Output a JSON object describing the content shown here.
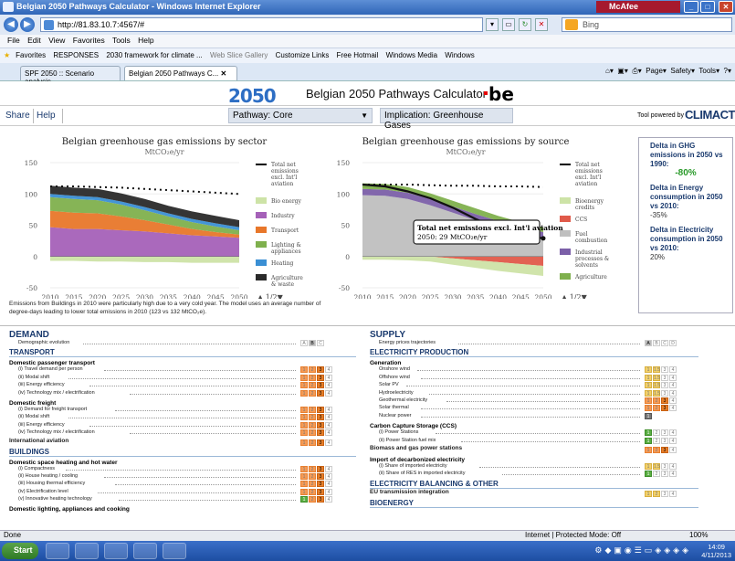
{
  "window": {
    "title": "Belgian 2050 Pathways Calculator - Windows Internet Explorer",
    "mcafee": "McAfee"
  },
  "address": {
    "url": "http://81.83.10.7:4567/#",
    "search_placeholder": "Bing"
  },
  "menu": [
    "File",
    "Edit",
    "View",
    "Favorites",
    "Tools",
    "Help"
  ],
  "favorites": {
    "label": "Favorites",
    "items": [
      "RESPONSES",
      "2030 framework for climate ...",
      "Web Slice Gallery",
      "Customize Links",
      "Free Hotmail",
      "Windows Media",
      "Windows"
    ]
  },
  "tabs": [
    {
      "label": "SPF 2050 :: Scenario analysis"
    },
    {
      "label": "Belgian 2050 Pathways C..."
    }
  ],
  "ie_tools": {
    "page": "Page",
    "safety": "Safety",
    "tools": "Tools"
  },
  "app": {
    "logo": "2050",
    "title": "Belgian 2050 Pathways Calculator",
    "country": "be",
    "share": "Share",
    "help": "Help",
    "pathway": "Pathway: Core",
    "implication": "Implication: Greenhouse Gases",
    "powered_by": "Tool powered by",
    "brand": "CLIMACT"
  },
  "chart_data": [
    {
      "type": "area",
      "title": "Belgian greenhouse gas emissions by sector",
      "subtitle": "MtCO₂e/yr",
      "x": [
        2010,
        2015,
        2020,
        2025,
        2030,
        2035,
        2040,
        2045,
        2050
      ],
      "ylim": [
        -50,
        150
      ],
      "yticks": [
        -50,
        0,
        50,
        100,
        150
      ],
      "series": [
        {
          "name": "Industry",
          "color": "#a561b8",
          "values": [
            47,
            44,
            44,
            42,
            40,
            37,
            34,
            32,
            30
          ]
        },
        {
          "name": "Transport",
          "color": "#e8772a",
          "values": [
            26,
            26,
            25,
            22,
            18,
            14,
            10,
            7,
            5
          ]
        },
        {
          "name": "Lighting & appliances",
          "color": "#7fb04d",
          "values": [
            22,
            22,
            21,
            19,
            16,
            13,
            11,
            9,
            7
          ]
        },
        {
          "name": "Heating",
          "color": "#3a8fd4",
          "values": [
            5,
            5,
            5,
            5,
            5,
            5,
            5,
            5,
            5
          ]
        },
        {
          "name": "Agriculture & waste",
          "color": "#2a2a2a",
          "values": [
            13,
            13,
            13,
            13,
            13,
            12,
            12,
            12,
            11
          ]
        },
        {
          "name": "Bio energy",
          "color": "#cde3a7",
          "values": [
            -7,
            -7,
            -8,
            -8,
            -9,
            -9,
            -10,
            -10,
            -10
          ]
        }
      ],
      "lines": [
        {
          "name": "Total net emissions excl. Int'l aviation",
          "values": [
            112,
            112,
            111,
            109,
            102,
            93,
            82,
            72,
            62
          ]
        }
      ],
      "legend_page": "1/2"
    },
    {
      "type": "area",
      "title": "Belgian greenhouse gas emissions by source",
      "subtitle": "MtCO₂e/yr",
      "x": [
        2010,
        2015,
        2020,
        2025,
        2030,
        2035,
        2040,
        2045,
        2050
      ],
      "ylim": [
        -50,
        150
      ],
      "yticks": [
        -50,
        0,
        50,
        100,
        150
      ],
      "series": [
        {
          "name": "Fuel combustion",
          "color": "#bfbfbf",
          "values": [
            98,
            97,
            92,
            82,
            70,
            58,
            47,
            37,
            29
          ]
        },
        {
          "name": "Industrial processes & solvents",
          "color": "#7b5fa8",
          "values": [
            10,
            10,
            10,
            10,
            10,
            10,
            10,
            10,
            10
          ]
        },
        {
          "name": "CCS",
          "color": "#e05a4a",
          "values": [
            0,
            0,
            0,
            0,
            -3,
            -6,
            -9,
            -12,
            -15
          ]
        },
        {
          "name": "Agriculture",
          "color": "#7fb04d",
          "values": [
            9,
            9,
            9,
            9,
            9,
            9,
            8,
            8,
            8
          ]
        },
        {
          "name": "Bioenergy credits",
          "color": "#cde3a7",
          "values": [
            -5,
            -5,
            -6,
            -8,
            -10,
            -12,
            -14,
            -15,
            -16
          ]
        }
      ],
      "lines": [
        {
          "name": "Total net emissions excl. Int'l aviation",
          "values": [
            115,
            112,
            104,
            93,
            78,
            60,
            45,
            35,
            29
          ]
        }
      ],
      "tooltip": {
        "title": "Total net emissions excl. Int'l aviation",
        "text": "2050: 29 MtCO₂e/yr"
      },
      "legend_page": "1/2"
    }
  ],
  "note": "Emissions from Buildings in 2010 were particularly high due to a very cold year. The model uses an average number of degree-days leading to lower total emissions in 2010 (123 vs 132 MtCO₂e).",
  "delta": [
    {
      "label": "Delta in GHG emissions in 2050 vs 1990:",
      "value": "-80%"
    },
    {
      "label": "Delta in Energy consumption in 2050 vs 2010:",
      "value": "-35%"
    },
    {
      "label": "Delta in Electricity consumption in 2050 vs 2010:",
      "value": "20%"
    }
  ],
  "demand": {
    "title": "DEMAND",
    "lines": [
      {
        "label": "Demographic evolution",
        "cells": [
          "A",
          "B",
          "C"
        ],
        "style": [
          "",
          "sel",
          ""
        ]
      }
    ],
    "sections": [
      {
        "title": "TRANSPORT",
        "groups": [
          {
            "title": "Domestic passenger transport",
            "lines": [
              {
                "label": "(i) Travel demand per person",
                "cells": [
                  "1",
                  "2",
                  "3",
                  "4"
                ],
                "style": [
                  "o1",
                  "o1",
                  "o2",
                  ""
                ]
              },
              {
                "label": "(ii) Modal shift",
                "cells": [
                  "1",
                  "2",
                  "3",
                  "4"
                ],
                "style": [
                  "o1",
                  "o1",
                  "o2",
                  ""
                ]
              },
              {
                "label": "(iii) Energy efficiency",
                "cells": [
                  "1",
                  "2",
                  "3",
                  "4"
                ],
                "style": [
                  "o1",
                  "o1",
                  "o2",
                  ""
                ]
              },
              {
                "label": "(iv) Technology mix / electrification",
                "cells": [
                  "1",
                  "2",
                  "3",
                  "4"
                ],
                "style": [
                  "o1",
                  "o1",
                  "o2",
                  ""
                ]
              }
            ]
          },
          {
            "title": "Domestic freight",
            "lines": [
              {
                "label": "(i) Demand for freight transport",
                "cells": [
                  "1",
                  "2",
                  "3",
                  "4"
                ],
                "style": [
                  "o1",
                  "o1",
                  "o2",
                  ""
                ]
              },
              {
                "label": "(ii) Modal shift",
                "cells": [
                  "1",
                  "2",
                  "3",
                  "4"
                ],
                "style": [
                  "o1",
                  "o1",
                  "o2",
                  ""
                ]
              },
              {
                "label": "(iii) Energy efficiency",
                "cells": [
                  "1",
                  "2",
                  "3",
                  "4"
                ],
                "style": [
                  "o1",
                  "o1",
                  "o2",
                  ""
                ]
              },
              {
                "label": "(iv) Technology mix / electrification",
                "cells": [
                  "1",
                  "2",
                  "3",
                  "4"
                ],
                "style": [
                  "o1",
                  "o1",
                  "o2",
                  ""
                ]
              }
            ]
          },
          {
            "title": "International aviation",
            "lines": [
              {
                "label": "",
                "cells": [
                  "1",
                  "2",
                  "3",
                  "4"
                ],
                "style": [
                  "o1",
                  "o1",
                  "o2",
                  ""
                ]
              }
            ]
          }
        ]
      },
      {
        "title": "BUILDINGS",
        "groups": [
          {
            "title": "Domestic space heating and hot water",
            "lines": [
              {
                "label": "(i) Compactness",
                "cells": [
                  "1",
                  "2",
                  "3",
                  "4"
                ],
                "style": [
                  "o1",
                  "o1",
                  "o2",
                  ""
                ]
              },
              {
                "label": "(ii) House heating / cooling",
                "cells": [
                  "1",
                  "2",
                  "3",
                  "4"
                ],
                "style": [
                  "o1",
                  "o1",
                  "o2",
                  ""
                ]
              },
              {
                "label": "(iii) Housing thermal efficiency",
                "cells": [
                  "1",
                  "2",
                  "3",
                  "4"
                ],
                "style": [
                  "o1",
                  "o1",
                  "o2",
                  ""
                ]
              },
              {
                "label": "(iv) Electrification level",
                "cells": [
                  "1",
                  "2",
                  "3",
                  "4"
                ],
                "style": [
                  "o1",
                  "o1",
                  "o2",
                  ""
                ]
              },
              {
                "label": "(v) Innovative heating technology",
                "cells": [
                  "1",
                  "2",
                  "3",
                  "4"
                ],
                "style": [
                  "g1",
                  "o1",
                  "o2",
                  ""
                ]
              }
            ]
          },
          {
            "title": "Domestic lighting, appliances and cooking",
            "lines": []
          }
        ]
      }
    ]
  },
  "supply": {
    "title": "SUPPLY",
    "lines": [
      {
        "label": "Energy prices trajectories",
        "cells": [
          "A",
          "B",
          "C",
          "D"
        ],
        "style": [
          "sel",
          "",
          "",
          ""
        ]
      }
    ],
    "sections": [
      {
        "title": "ELECTRICITY PRODUCTION",
        "groups": [
          {
            "title": "Generation",
            "lines": [
              {
                "label": "Onshore wind",
                "cells": [
                  "1",
                  "1.5",
                  "3",
                  "4"
                ],
                "style": [
                  "y1",
                  "y1",
                  "",
                  ""
                ]
              },
              {
                "label": "Offshore wind",
                "cells": [
                  "1",
                  "1.5",
                  "3",
                  "4"
                ],
                "style": [
                  "y1",
                  "y1",
                  "",
                  ""
                ]
              },
              {
                "label": "Solar PV",
                "cells": [
                  "1",
                  "1.5",
                  "3",
                  "4"
                ],
                "style": [
                  "y1",
                  "y1",
                  "",
                  ""
                ]
              },
              {
                "label": "Hydroelectricity",
                "cells": [
                  "1",
                  "1.5",
                  "3",
                  "4"
                ],
                "style": [
                  "y1",
                  "y1",
                  "",
                  ""
                ]
              },
              {
                "label": "Geothermal electricity",
                "cells": [
                  "1",
                  "2",
                  "3",
                  "4"
                ],
                "style": [
                  "o1",
                  "o1",
                  "o2",
                  ""
                ]
              },
              {
                "label": "Solar thermal",
                "cells": [
                  "1",
                  "2",
                  "3",
                  "4"
                ],
                "style": [
                  "o1",
                  "o1",
                  "o2",
                  ""
                ]
              },
              {
                "label": "Nuclear power",
                "cells": [
                  "1"
                ],
                "style": [
                  "d1"
                ]
              }
            ]
          },
          {
            "title": "Carbon Capture Storage (CCS)",
            "lines": [
              {
                "label": "(i) Power Stations",
                "cells": [
                  "1",
                  "2",
                  "3",
                  "4"
                ],
                "style": [
                  "g1",
                  "",
                  "",
                  ""
                ]
              },
              {
                "label": "(ii) Power Station fuel mix",
                "cells": [
                  "1",
                  "2",
                  "3",
                  "4"
                ],
                "style": [
                  "g1",
                  "",
                  "",
                  ""
                ]
              }
            ]
          },
          {
            "title": "Biomass and gas power stations",
            "lines": [
              {
                "label": "",
                "cells": [
                  "1",
                  "2",
                  "3",
                  "4"
                ],
                "style": [
                  "o1",
                  "o1",
                  "o2",
                  ""
                ]
              }
            ]
          },
          {
            "title": "Import of decarbonized electricity",
            "lines": [
              {
                "label": "(i) Share of imported electricity",
                "cells": [
                  "1",
                  "1.5",
                  "3",
                  "4"
                ],
                "style": [
                  "y1",
                  "y1",
                  "",
                  ""
                ]
              },
              {
                "label": "(ii) Share of RES in imported electricity",
                "cells": [
                  "1",
                  "2",
                  "3",
                  "4"
                ],
                "style": [
                  "g1",
                  "",
                  "",
                  ""
                ]
              }
            ]
          }
        ]
      },
      {
        "title": "ELECTRICITY BALANCING & OTHER",
        "groups": [
          {
            "title": "EU transmission integration",
            "lines": [
              {
                "label": "",
                "cells": [
                  "1",
                  "2",
                  "3",
                  "4"
                ],
                "style": [
                  "y1",
                  "y1",
                  "",
                  ""
                ]
              }
            ]
          }
        ]
      },
      {
        "title": "BIOENERGY",
        "groups": []
      }
    ]
  },
  "status": {
    "left": "Done",
    "zone": "Internet | Protected Mode: Off",
    "zoom": "100%"
  },
  "taskbar": {
    "start": "Start",
    "time": "14:09",
    "date": "4/11/2013"
  }
}
